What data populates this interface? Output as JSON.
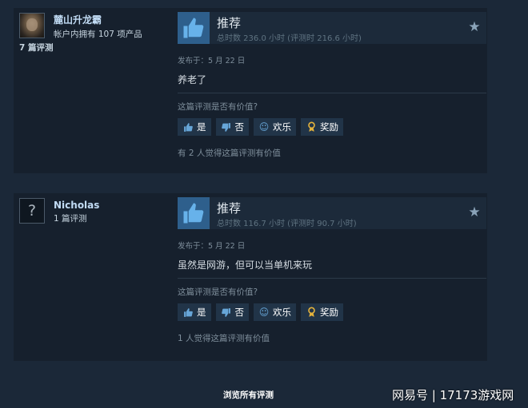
{
  "reviews": [
    {
      "author_name": "麓山升龙霸",
      "author_owned": "帐户内拥有 107 项产品",
      "author_review_count": "7 篇评测",
      "avatar": "user-photo",
      "verdict": "推荐",
      "hours": "总时数 236.0 小时   (评测时 216.6 小时)",
      "posted": "发布于：5 月 22 日",
      "text": "养老了",
      "question": "这篇评测是否有价值?",
      "btn_yes": "是",
      "btn_no": "否",
      "btn_funny": "欢乐",
      "btn_award": "奖励",
      "helpful": "有 2 人觉得这篇评测有价值"
    },
    {
      "author_name": "Nicholas",
      "author_review_count": "1 篇评测",
      "avatar": "?",
      "verdict": "推荐",
      "hours": "总时数 116.7 小时   (评测时 90.7 小时)",
      "posted": "发布于：5 月 22 日",
      "text": "虽然是网游，但可以当单机来玩",
      "question": "这篇评测是否有价值?",
      "btn_yes": "是",
      "btn_no": "否",
      "btn_funny": "欢乐",
      "btn_award": "奖励",
      "helpful": "1 人觉得这篇评测有价值"
    }
  ],
  "browse_all": "浏览所有评测",
  "watermark": "网易号 | 17173游戏网",
  "icons": {
    "thumb": "thumbs-up-icon",
    "star": "star-icon",
    "yes": "thumbs-up-icon",
    "no": "thumbs-down-icon",
    "funny": "smiley-icon",
    "award": "award-icon"
  },
  "colors": {
    "background": "#1b2838",
    "card": "#16202d",
    "thumb_box": "#2e5f8c",
    "button": "#213448",
    "author_name": "#c1dbf4"
  }
}
